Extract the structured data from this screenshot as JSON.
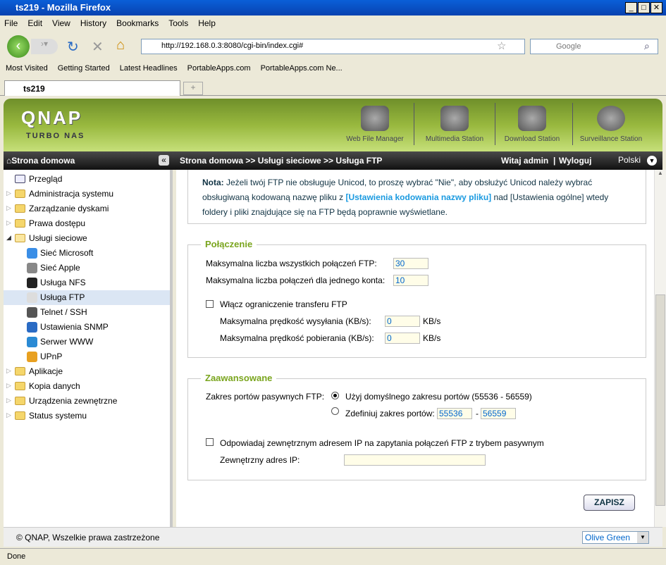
{
  "window": {
    "title": "ts219 - Mozilla Firefox"
  },
  "menu": [
    "File",
    "Edit",
    "View",
    "History",
    "Bookmarks",
    "Tools",
    "Help"
  ],
  "nav": {
    "url": "http://192.168.0.3:8080/cgi-bin/index.cgi#",
    "search_placeholder": "Google"
  },
  "bookmarks": [
    "Most Visited",
    "Getting Started",
    "Latest Headlines",
    "PortableApps.com",
    "PortableApps.com Ne..."
  ],
  "tab": {
    "label": "ts219"
  },
  "header": {
    "logo": "QNAP",
    "subtitle": "TURBO NAS",
    "apps": [
      "Web File Manager",
      "Multimedia Station",
      "Download Station",
      "Surveillance Station"
    ]
  },
  "bar": {
    "home": "Strona domowa",
    "breadcrumb": "Strona domowa >> Usługi sieciowe >> Usługa FTP",
    "welcome": "Witaj admin",
    "logout": "Wyloguj",
    "language": "Polski"
  },
  "sidebar": [
    {
      "label": "Przegląd",
      "type": "leaf"
    },
    {
      "label": "Administracja systemu",
      "type": "folder"
    },
    {
      "label": "Zarządzanie dyskami",
      "type": "folder"
    },
    {
      "label": "Prawa dostępu",
      "type": "folder"
    },
    {
      "label": "Usługi sieciowe",
      "type": "open"
    },
    {
      "label": "Sieć Microsoft",
      "type": "child",
      "color": "#3a8ee6"
    },
    {
      "label": "Sieć Apple",
      "type": "child",
      "color": "#888888"
    },
    {
      "label": "Usługa NFS",
      "type": "child",
      "color": "#222222"
    },
    {
      "label": "Usługa FTP",
      "type": "child",
      "color": "#dddddd",
      "selected": true
    },
    {
      "label": "Telnet / SSH",
      "type": "child",
      "color": "#555555"
    },
    {
      "label": "Ustawienia SNMP",
      "type": "child",
      "color": "#2a6bc4"
    },
    {
      "label": "Serwer WWW",
      "type": "child",
      "color": "#2a8ad4"
    },
    {
      "label": "UPnP",
      "type": "child",
      "color": "#e8a020"
    },
    {
      "label": "Aplikacje",
      "type": "folder"
    },
    {
      "label": "Kopia danych",
      "type": "folder"
    },
    {
      "label": "Urządzenia zewnętrzne",
      "type": "folder"
    },
    {
      "label": "Status systemu",
      "type": "folder"
    }
  ],
  "note": {
    "prefix": "Nota:",
    "text1": " Jeżeli twój FTP nie obsługuje Unicod, to proszę wybrać \"Nie\", aby obsłużyć Unicod należy wybrać obsługiwaną kodowaną nazwę pliku z ",
    "link": "[Ustawienia kodowania nazwy pliku]",
    "text2": " nad [Ustawienia ogólne] wtedy foldery i pliki znajdujące się na FTP będą poprawnie wyświetlane."
  },
  "connection": {
    "legend": "Połączenie",
    "max_all_label": "Maksymalna liczba wszystkich połączeń FTP:",
    "max_all": "30",
    "max_account_label": "Maksymalna liczba połączeń dla jednego konta:",
    "max_account": "10",
    "limit_label": "Włącz ograniczenie transferu FTP",
    "limit_checked": false,
    "upload_label": "Maksymalna prędkość wysyłania (KB/s):",
    "upload": "0",
    "download_label": "Maksymalna prędkość pobierania (KB/s):",
    "download": "0",
    "unit": "KB/s"
  },
  "advanced": {
    "legend": "Zaawansowane",
    "passive_label": "Zakres portów pasywnych FTP:",
    "default_option": "Użyj domyślnego zakresu portów (55536 - 56559)",
    "custom_option": "Zdefiniuj zakres portów:",
    "port_from": "55536",
    "port_sep": "-",
    "port_to": "56559",
    "external_label": "Odpowiadaj zewnętrznym adresem IP na zapytania połączeń FTP z trybem pasywnym",
    "external_checked": false,
    "ip_label": "Zewnętrzny adres IP:",
    "ip": ""
  },
  "save_label": "ZAPISZ",
  "footer": {
    "copyright": "© QNAP, Wszelkie prawa zastrzeżone",
    "theme": "Olive Green"
  },
  "status": "Done",
  "colors": {
    "accent": "#7aa51e",
    "link": "#1a9ae0",
    "header": "#98b83e"
  }
}
